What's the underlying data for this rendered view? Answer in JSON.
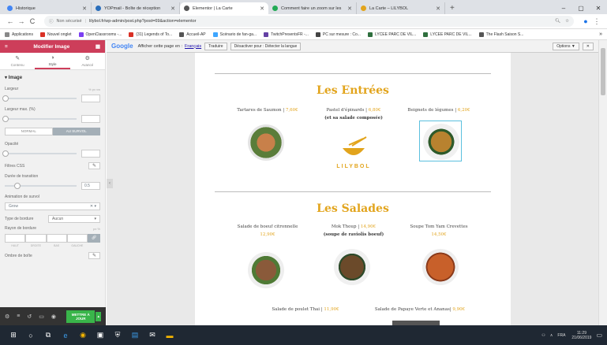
{
  "browser": {
    "tabs": [
      {
        "label": "Historique",
        "color": "#4285f4",
        "active": false
      },
      {
        "label": "YOPmail - Boîte de réception",
        "color": "#2a6ebb",
        "active": false
      },
      {
        "label": "Elementor | La Carte",
        "color": "#555555",
        "active": true
      },
      {
        "label": "Comment faire un zoom sur les",
        "color": "#22aa55",
        "active": false
      },
      {
        "label": "La Carte – LILYBOL",
        "color": "#e2a41c",
        "active": false
      }
    ],
    "new_tab": "+",
    "minimize": "–",
    "maximize": "▢",
    "close": "✕",
    "security": "Non sécurisé",
    "url": "lilybol.fr/wp-admin/post.php?post=69&action=elementor",
    "bookmarks": [
      {
        "label": "Applications",
        "color": "#888888"
      },
      {
        "label": "Nouvel onglet",
        "color": "#d93025"
      },
      {
        "label": "OpenClassrooms -...",
        "color": "#7b3ff2"
      },
      {
        "label": "(31) Legends of To...",
        "color": "#d93025"
      },
      {
        "label": "Accueil-AP",
        "color": "#555555"
      },
      {
        "label": "Scénario de fan-ga...",
        "color": "#3ea6ff"
      },
      {
        "label": "TwitchPresentsFR -...",
        "color": "#6441a4"
      },
      {
        "label": "PC sur mesure : Co...",
        "color": "#444444"
      },
      {
        "label": "LYCEE PARC DE VIL...",
        "color": "#2f6f3e"
      },
      {
        "label": "LYCEE PARC DE VIL...",
        "color": "#2f6f3e"
      },
      {
        "label": "The Flash Saison S...",
        "color": "#555555"
      }
    ],
    "bookmarks_more": "»"
  },
  "panel": {
    "title": "Modifier Image",
    "tabs": [
      {
        "label": "Contenu",
        "icon": "✎",
        "active": false
      },
      {
        "label": "Style",
        "icon": "◑",
        "active": true
      },
      {
        "label": "Avancé",
        "icon": "⚙",
        "active": false
      }
    ],
    "section": "Image",
    "width_label": "Largeur",
    "width_unit": "% px vw",
    "maxwidth_label": "Largeur max. (%)",
    "state_normal": "NORMAL",
    "state_hover": "AU SURVOL",
    "opacity_label": "Opacité",
    "css_filters_label": "Filtres CSS",
    "transition_label": "Durée de transition",
    "transition_value": "0.5",
    "hover_anim_label": "Animation de survol",
    "hover_anim_value": "Grow",
    "border_type_label": "Type de bordure",
    "border_type_value": "Aucun",
    "radius_label": "Rayon de bordure",
    "radius_cells": [
      "HAUT",
      "DROITE",
      "BAS",
      "GAUCHE"
    ],
    "shadow_label": "Ombre de boîte",
    "publish_label": "METTRE À JOUR"
  },
  "translate_bar": {
    "google": "Google",
    "text": "Afficher cette page en :",
    "language": "Français",
    "translate_btn": "Traduire",
    "disable_btn": "Désactiver pour : Détecter la langue",
    "options_btn": "Options ▼"
  },
  "menu": {
    "entrees_title": "Les Entrées",
    "entrees": [
      {
        "name": "Tartares de Saumon",
        "price": "7,60€",
        "sub": ""
      },
      {
        "name": "Pastel d'épinards",
        "price": "6,80€",
        "sub": "(et sa salade composée)"
      },
      {
        "name": "Beignets de légumes",
        "price": "6,20€",
        "sub": ""
      }
    ],
    "logo_text": "LILYBOL",
    "salades_title": "Les Salades",
    "salades": [
      {
        "name": "Salade de boeuf citronnelle",
        "price": "12,90€",
        "sub": ""
      },
      {
        "name": "Mok Thoup",
        "price": "14,90€",
        "sub": "(soupe de raviolis boeuf)"
      },
      {
        "name": "Soupe Tom Yam Crevettes",
        "price": "14,50€",
        "sub": ""
      }
    ],
    "bottom_left": {
      "name": "Salade de poulet Thai",
      "price": "11,90€"
    },
    "bottom_right": {
      "name": "Salade de Papaye Verte et Ananas",
      "price": "9,90€"
    }
  },
  "taskbar": {
    "lang": "FRA",
    "time": "11:29",
    "date": "21/06/2019"
  },
  "colors": {
    "accent": "#cd3e5a",
    "gold": "#e2a41c",
    "publish": "#39b54a"
  }
}
